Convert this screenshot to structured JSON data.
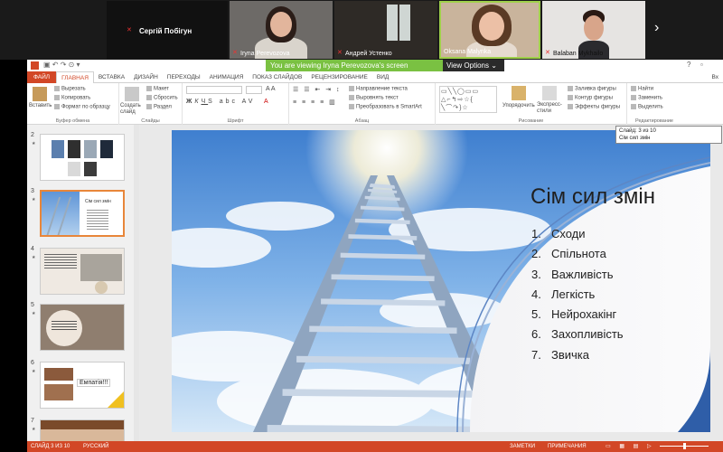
{
  "call": {
    "participants": [
      {
        "name": "Сергій Побігун",
        "video": false
      },
      {
        "name": "Iryna Perevozova",
        "video": true
      },
      {
        "name": "Андрей Устенко",
        "video": true
      },
      {
        "name": "Oksana Malynka",
        "video": true
      },
      {
        "name": "Balaban Mykhailo",
        "video": true
      }
    ],
    "sharing_text": "You are viewing Iryna Perevozova's screen",
    "view_options": "View Options"
  },
  "ppt": {
    "tabs": [
      "ФАЙЛ",
      "ГЛАВНАЯ",
      "ВСТАВКА",
      "ДИЗАЙН",
      "ПЕРЕХОДЫ",
      "АНИМАЦИЯ",
      "ПОКАЗ СЛАЙДОВ",
      "РЕЦЕНЗИРОВАНИЕ",
      "ВИД"
    ],
    "active_tab": "ГЛАВНАЯ",
    "signin": "Вх",
    "ribbon": {
      "paste": "Вставить",
      "cut": "Вырезать",
      "copy": "Копировать",
      "format_painter": "Формат по образцу",
      "clipboard_group": "Буфер обмена",
      "new_slide": "Создать слайд",
      "layout": "Макет",
      "reset": "Сбросить",
      "section": "Раздел",
      "slides_group": "Слайды",
      "font_group": "Шрифт",
      "text_direction": "Направление текста",
      "align_text": "Выровнять текст",
      "smartart": "Преобразовать в SmartArt",
      "paragraph_group": "Абзац",
      "arrange": "Упорядочить",
      "quick_styles": "Экспресс-стили",
      "shape_fill": "Заливка фигуры",
      "shape_outline": "Контур фигуры",
      "shape_effects": "Эффекты фигуры",
      "drawing_group": "Рисование",
      "find": "Найти",
      "replace": "Заменить",
      "select": "Выделить",
      "editing_group": "Редактирование"
    },
    "thumbnails": [
      {
        "num": "2",
        "label": ""
      },
      {
        "num": "3",
        "label": "Сім сил змін"
      },
      {
        "num": "4",
        "label": ""
      },
      {
        "num": "5",
        "label": ""
      },
      {
        "num": "6",
        "label": "Емпатія!!!"
      },
      {
        "num": "7",
        "label": ""
      }
    ],
    "slide": {
      "title": "Сім сил змін",
      "items": [
        "Сходи",
        "Спільнота",
        "Важливість",
        "Легкість",
        "Нейрохакінг",
        "Захопливість",
        "Звичка"
      ]
    },
    "tooltip": {
      "line1": "Слайд: 3 из 10",
      "line2": "Сім сил змін"
    },
    "status": {
      "slide": "СЛАЙД 3 ИЗ 10",
      "lang": "РУССКИЙ",
      "notes": "ЗАМЕТКИ",
      "comments": "ПРИМЕЧАНИЯ"
    }
  }
}
